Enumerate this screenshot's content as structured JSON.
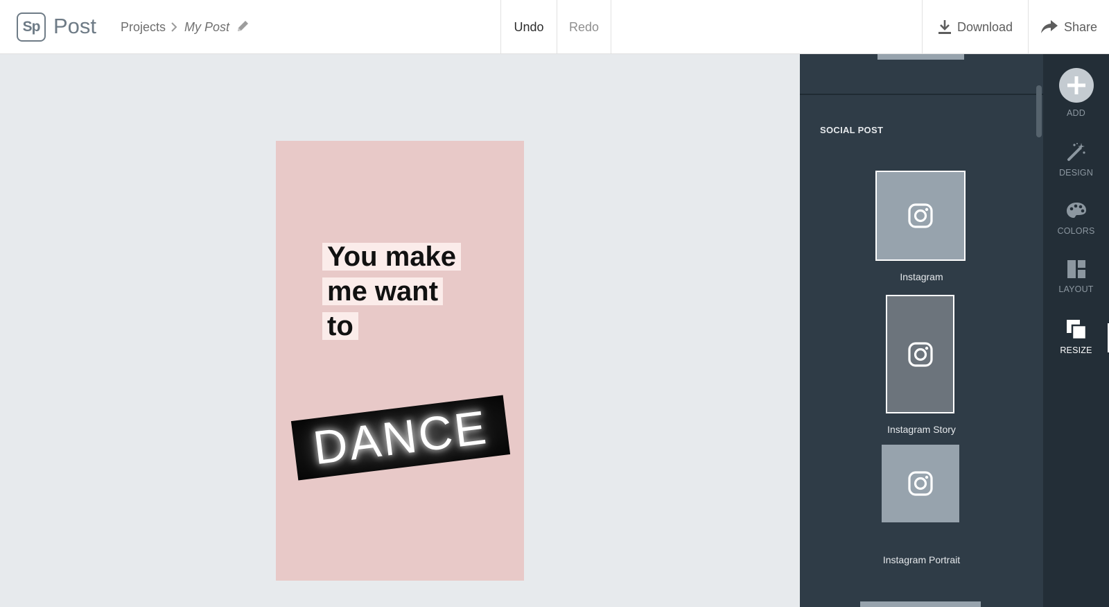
{
  "header": {
    "logo_text": "Sp",
    "app_name": "Post",
    "breadcrumb": {
      "projects": "Projects",
      "current": "My Post"
    },
    "undo_label": "Undo",
    "redo_label": "Redo",
    "download_label": "Download",
    "share_label": "Share"
  },
  "canvas": {
    "text_lines": [
      "You make",
      "me want",
      "to"
    ],
    "image_text": "DANCE",
    "background_color": "#e8c9c8"
  },
  "panel": {
    "section_title": "SOCIAL POST",
    "items": [
      {
        "label": "Instagram",
        "icon": "instagram-icon",
        "selected": true
      },
      {
        "label": "Instagram Story",
        "icon": "instagram-icon",
        "selected": false
      },
      {
        "label": "Instagram Portrait",
        "icon": "instagram-icon",
        "selected": false
      }
    ]
  },
  "tools": {
    "add": "ADD",
    "design": "DESIGN",
    "colors": "COLORS",
    "layout": "LAYOUT",
    "resize": "RESIZE",
    "active": "RESIZE"
  },
  "colors": {
    "panel_bg": "#2f3c47",
    "rail_bg": "#232e37",
    "thumb_bg": "#97a3ad"
  }
}
